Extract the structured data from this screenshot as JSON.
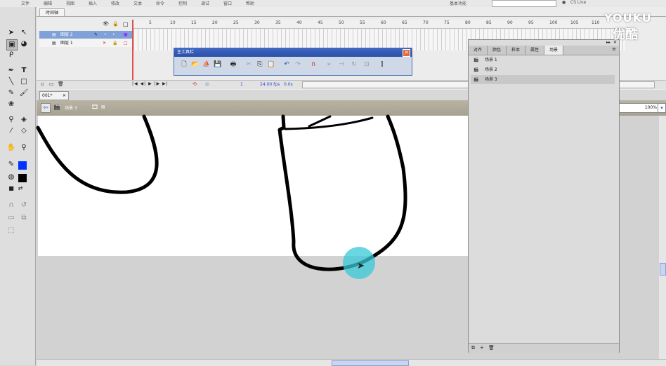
{
  "menubar": {
    "items": [
      "文件",
      "编辑",
      "视图",
      "插入",
      "修改",
      "文本",
      "命令",
      "控制",
      "调试",
      "窗口",
      "帮助"
    ],
    "workspace": "基本功能",
    "search_placeholder": "",
    "cslive": "CS Live"
  },
  "timeline": {
    "tab_label": "时间轴",
    "layers": [
      {
        "name": "图层 2",
        "selected": true
      },
      {
        "name": "图层 1",
        "selected": false
      }
    ],
    "frame_numbers": [
      "5",
      "10",
      "15",
      "20",
      "25",
      "30",
      "35",
      "40",
      "45",
      "50",
      "55",
      "60",
      "65",
      "70",
      "75",
      "80",
      "85",
      "90",
      "95",
      "100",
      "105",
      "110"
    ],
    "fps": "24.00 fps",
    "time": "0.0s",
    "frame": "1"
  },
  "main_toolbar": {
    "title": "主工具栏"
  },
  "document": {
    "tab_label": "001*",
    "scene_label": "场景 3",
    "zoom": "100%"
  },
  "scene_panel": {
    "tabs": [
      "对齐",
      "颜色",
      "样本",
      "属性",
      "场景"
    ],
    "active_tab": "场景",
    "scenes": [
      "场景 1",
      "场景 2",
      "场景 3"
    ],
    "selected_scene": "场景 3"
  },
  "watermark": {
    "brand": "YOUKU",
    "brand_cn": "优酷"
  },
  "colors": {
    "stroke": "#0033ff",
    "fill": "#000000",
    "cursor_highlight": "#38c8d7"
  }
}
